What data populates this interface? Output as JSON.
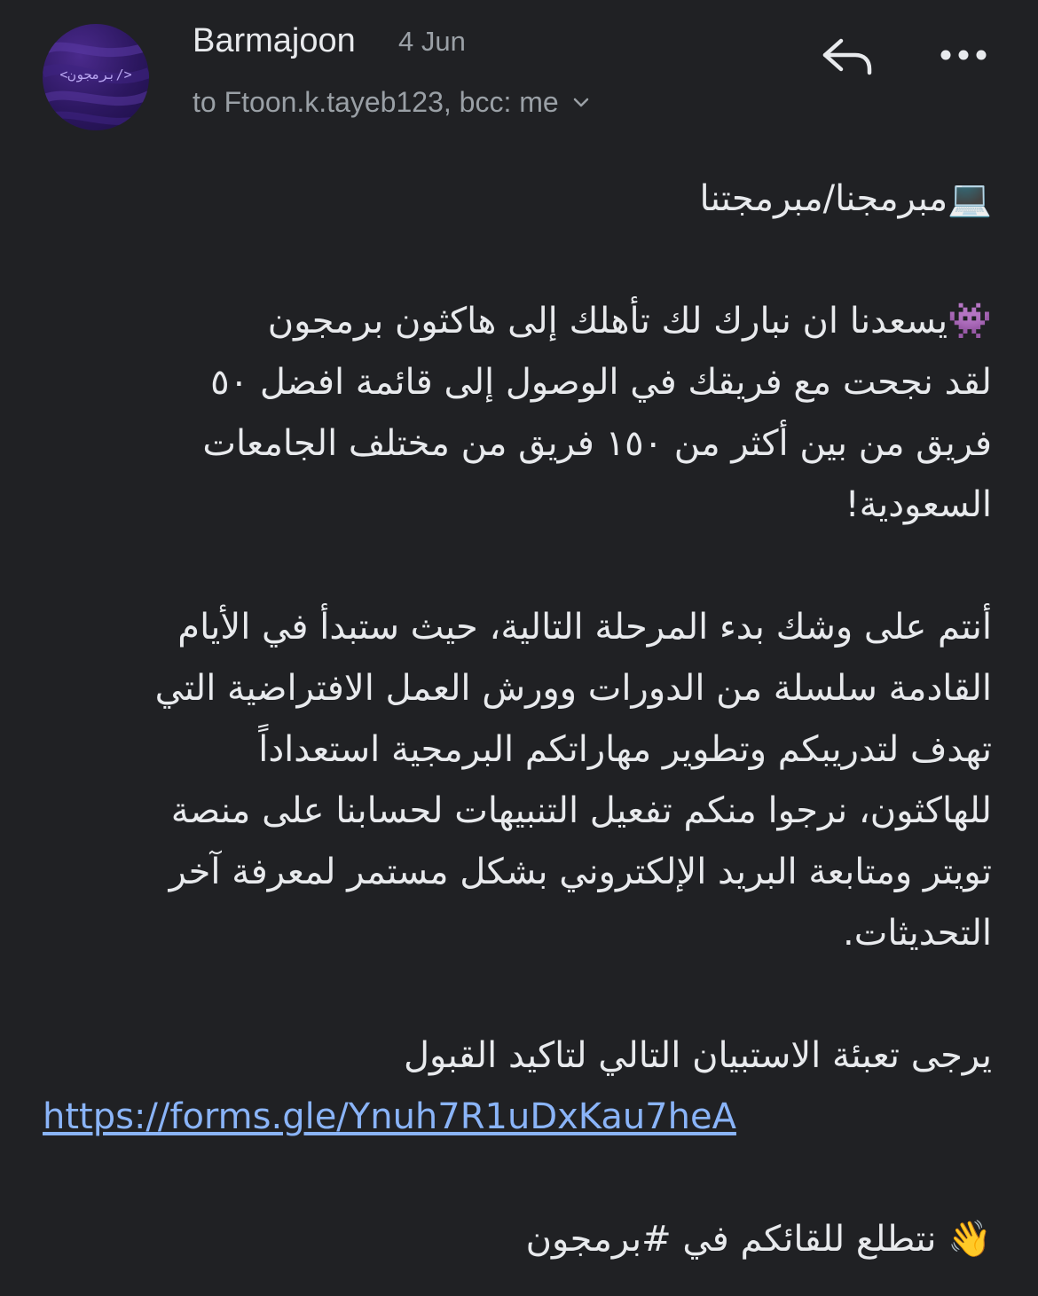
{
  "header": {
    "avatar_text": "</برمجون>",
    "sender": "Barmajoon",
    "date": "4 Jun",
    "recipients": "to Ftoon.k.tayeb123, bcc: me"
  },
  "body": {
    "greeting": "💻مبرمجنا/مبرمجتنا",
    "p1_lines": [
      "👾يسعدنا ان نبارك لك تأهلك إلى هاكثون برمجون",
      "لقد نجحت مع فريقك في الوصول إلى قائمة افضل ٥٠",
      "فريق من بين أكثر من ١٥٠ فريق من مختلف الجامعات",
      "السعودية!"
    ],
    "p2_lines": [
      "أنتم على وشك بدء المرحلة التالية، حيث ستبدأ في الأيام",
      "القادمة سلسلة من الدورات وورش العمل الافتراضية التي",
      "تهدف لتدريبكم وتطوير مهاراتكم البرمجية استعداداً",
      "للهاكثون، نرجوا منكم تفعيل التنبيهات لحسابنا على منصة",
      "تويتر ومتابعة البريد الإلكتروني بشكل مستمر لمعرفة آخر",
      "التحديثات."
    ],
    "form_request": "يرجى تعبئة الاستبيان التالي لتاكيد القبول",
    "form_link": "https://forms.gle/Ynuh7R1uDxKau7heA",
    "closing": "👋 نتطلع للقائكم في #برمجون"
  },
  "icons": {
    "reply": "reply-icon",
    "more": "more-vert-icon",
    "chevron": "chevron-down-icon"
  },
  "colors": {
    "background": "#202124",
    "text": "#e8eaed",
    "secondary_text": "#9aa0a6",
    "link": "#8ab4f8",
    "avatar_bg": "#2c1760"
  }
}
